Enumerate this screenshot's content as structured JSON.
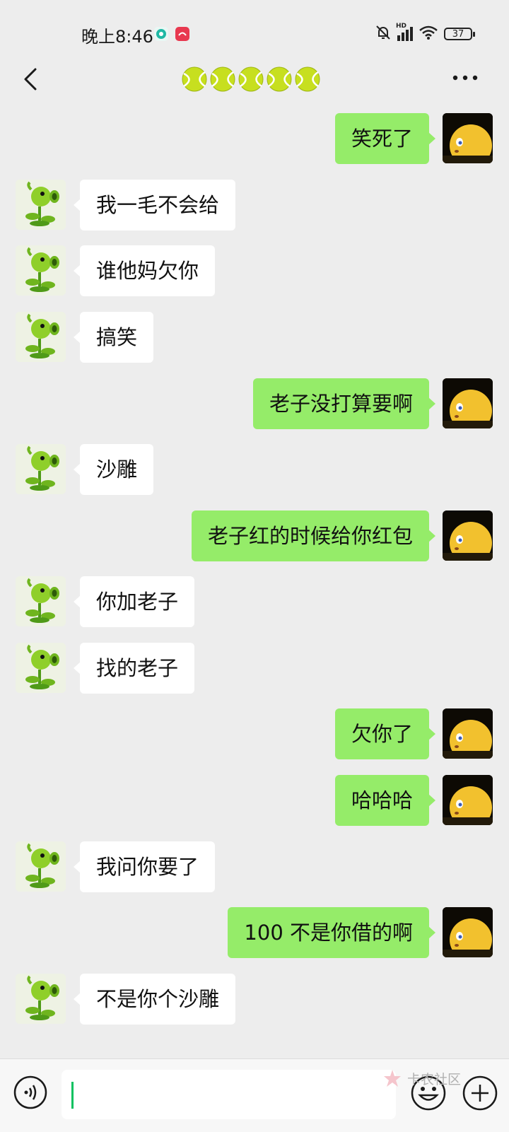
{
  "status_bar": {
    "time": "晚上8:46",
    "battery": "37",
    "network_label": "HD"
  },
  "header": {
    "title_icons": [
      "tennis-ball-icon",
      "tennis-ball-icon",
      "tennis-ball-icon",
      "tennis-ball-icon",
      "tennis-ball-icon"
    ]
  },
  "messages": [
    {
      "side": "right",
      "text": "笑死了"
    },
    {
      "side": "left",
      "text": "我一毛不会给"
    },
    {
      "side": "left",
      "text": "谁他妈欠你"
    },
    {
      "side": "left",
      "text": "搞笑"
    },
    {
      "side": "right",
      "text": "老子没打算要啊"
    },
    {
      "side": "left",
      "text": "沙雕"
    },
    {
      "side": "right",
      "text": "老子红的时候给你红包"
    },
    {
      "side": "left",
      "text": "你加老子"
    },
    {
      "side": "left",
      "text": "找的老子"
    },
    {
      "side": "right",
      "text": "欠你了"
    },
    {
      "side": "right",
      "text": "哈哈哈"
    },
    {
      "side": "left",
      "text": "我问你要了"
    },
    {
      "side": "right",
      "text": "100 不是你借的啊"
    },
    {
      "side": "left",
      "text": "不是你个沙雕"
    }
  ],
  "watermark": {
    "text": "卡农社区"
  },
  "colors": {
    "background": "#ededed",
    "self_bubble": "#95ec69",
    "other_bubble": "#ffffff",
    "caret": "#07c160"
  }
}
